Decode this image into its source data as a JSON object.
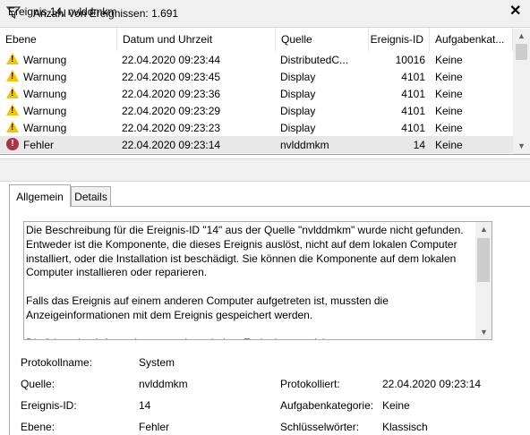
{
  "filter": {
    "label": "Anzahl von Ereignissen: 1.691",
    "icon": "funnel-icon"
  },
  "grid": {
    "columns": [
      "Ebene",
      "Datum und Uhrzeit",
      "Quelle",
      "Ereignis-ID",
      "Aufgabenkat..."
    ],
    "rows": [
      {
        "level": "Warnung",
        "icon": "warning-icon",
        "datetime": "22.04.2020 09:23:44",
        "source": "DistributedC...",
        "id": "10016",
        "task": "Keine"
      },
      {
        "level": "Warnung",
        "icon": "warning-icon",
        "datetime": "22.04.2020 09:23:45",
        "source": "Display",
        "id": "4101",
        "task": "Keine"
      },
      {
        "level": "Warnung",
        "icon": "warning-icon",
        "datetime": "22.04.2020 09:23:36",
        "source": "Display",
        "id": "4101",
        "task": "Keine"
      },
      {
        "level": "Warnung",
        "icon": "warning-icon",
        "datetime": "22.04.2020 09:23:29",
        "source": "Display",
        "id": "4101",
        "task": "Keine"
      },
      {
        "level": "Warnung",
        "icon": "warning-icon",
        "datetime": "22.04.2020 09:23:23",
        "source": "Display",
        "id": "4101",
        "task": "Keine"
      },
      {
        "level": "Fehler",
        "icon": "error-icon",
        "datetime": "22.04.2020 09:23:14",
        "source": "nvlddmkm",
        "id": "14",
        "task": "Keine"
      }
    ]
  },
  "detail": {
    "title": "Ereignis 14, nvlddmkm",
    "tabs": [
      "Allgemein",
      "Details"
    ],
    "description": "Die Beschreibung für die Ereignis-ID \"14\" aus der Quelle \"nvlddmkm\" wurde nicht gefunden.\nEntweder ist die Komponente, die dieses Ereignis auslöst, nicht auf dem lokalen Computer\ninstalliert, oder die Installation ist beschädigt. Sie können die Komponente auf dem lokalen\nComputer installieren oder reparieren.\n\nFalls das Ereignis auf einem anderen Computer aufgetreten ist, mussten die\nAnzeigeinformationen mit dem Ereignis gespeichert werden.\n\nDie folgenden Informationen wurden mit dem Ereignis gespeichert:",
    "props": {
      "protokollname_label": "Protokollname:",
      "protokollname": "System",
      "quelle_label": "Quelle:",
      "quelle": "nvlddmkm",
      "protokolliert_label": "Protokolliert:",
      "protokolliert": "22.04.2020 09:23:14",
      "ereignisid_label": "Ereignis-ID:",
      "ereignisid": "14",
      "kategorie_label": "Aufgabenkategorie:",
      "kategorie": "Keine",
      "ebene_label": "Ebene:",
      "ebene": "Fehler",
      "schluessel_label": "Schlüsselwörter:",
      "schluessel": "Klassisch"
    }
  },
  "colors": {
    "warning": "#f2c500",
    "error": "#a8334a",
    "selected_row": "#e8e8e8"
  }
}
